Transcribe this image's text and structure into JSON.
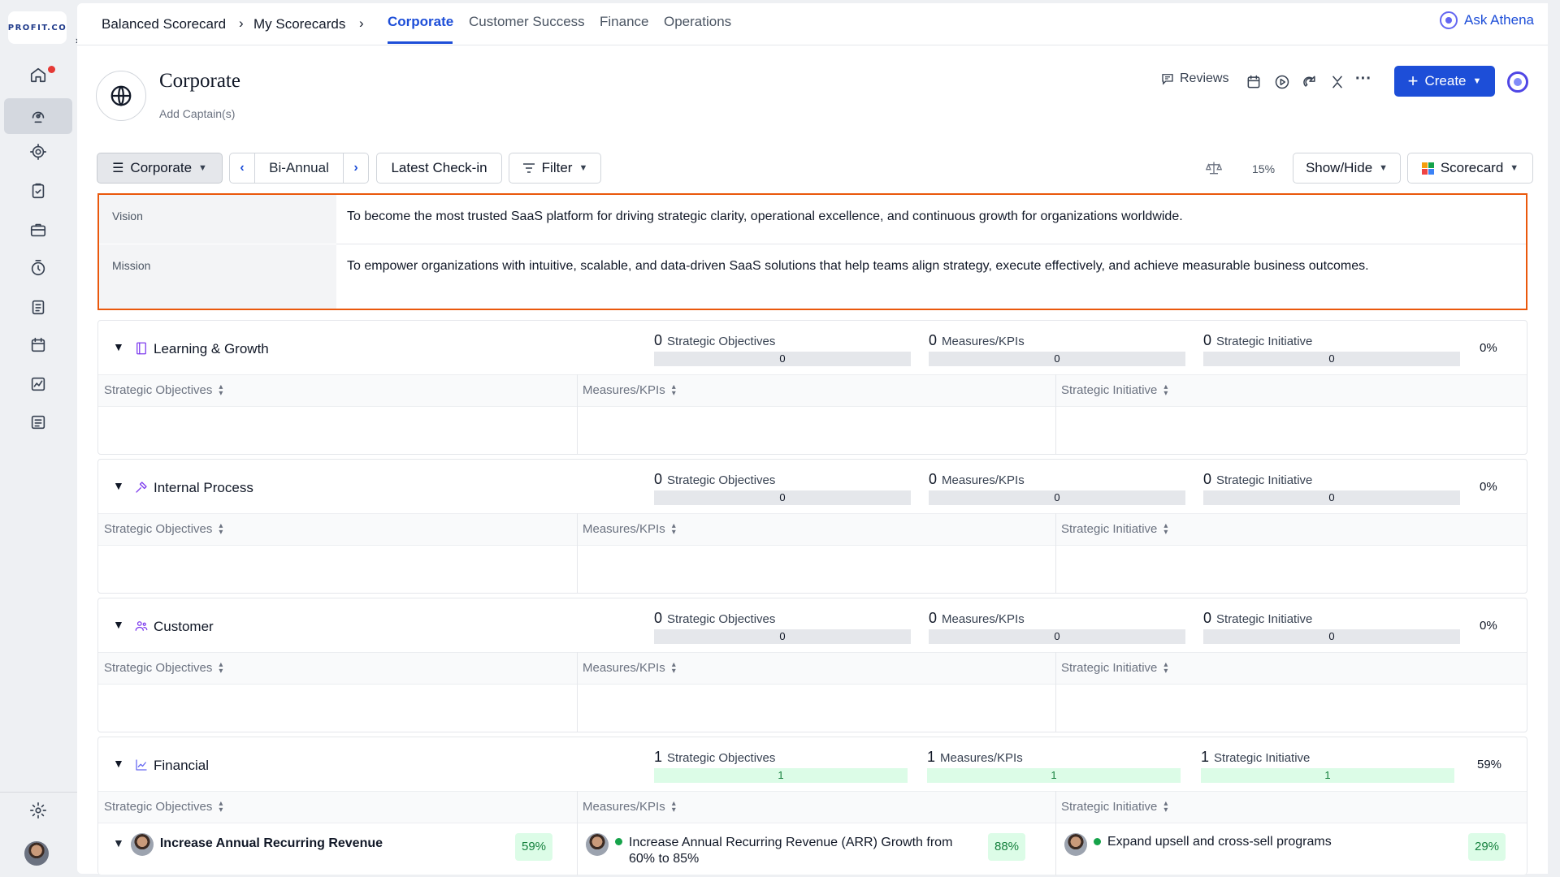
{
  "app": {
    "logo_text": "PROFIT.CO",
    "collapse_icon": "›"
  },
  "sidebar": {
    "items": [
      {
        "name": "home-icon"
      },
      {
        "name": "strategy-icon"
      },
      {
        "name": "target-icon"
      },
      {
        "name": "checklist-icon"
      },
      {
        "name": "briefcase-icon"
      },
      {
        "name": "timer-icon"
      },
      {
        "name": "clipboard-icon"
      },
      {
        "name": "calendar-icon"
      },
      {
        "name": "analytics-icon"
      },
      {
        "name": "list-icon"
      }
    ]
  },
  "breadcrumb": {
    "root": "Balanced Scorecard",
    "sep1": "›",
    "level2": "My Scorecards",
    "sep2": "›"
  },
  "tabs": [
    "Corporate",
    "Customer Success",
    "Finance",
    "Operations"
  ],
  "ask_athena": "Ask Athena",
  "header": {
    "title": "Corporate",
    "add_captain": "Add Captain(s)",
    "reviews": "Reviews",
    "more": "···",
    "create": "Create"
  },
  "toolbar": {
    "scorecard_select": "Corporate",
    "prev": "‹",
    "period": "Bi-Annual",
    "next": "›",
    "checkin": "Latest Check-in",
    "filter": "Filter",
    "weight_pct": "15%",
    "show_hide": "Show/Hide",
    "view": "Scorecard"
  },
  "vision_mission": [
    {
      "label": "Vision",
      "text": "To become the most trusted SaaS platform for driving strategic clarity, operational excellence, and continuous growth for organizations worldwide."
    },
    {
      "label": "Mission",
      "text": "To empower organizations with intuitive, scalable, and data-driven SaaS solutions that help teams align strategy, execute effectively, and achieve measurable business outcomes."
    }
  ],
  "columns": {
    "objectives": "Strategic Objectives",
    "measures": "Measures/KPIs",
    "initiatives": "Strategic Initiative"
  },
  "perspectives": [
    {
      "name": "Learning & Growth",
      "obj_count": "0",
      "obj_bar": "0",
      "kpi_count": "0",
      "kpi_bar": "0",
      "ini_count": "0",
      "ini_bar": "0",
      "progress": "0%"
    },
    {
      "name": "Internal Process",
      "obj_count": "0",
      "obj_bar": "0",
      "kpi_count": "0",
      "kpi_bar": "0",
      "ini_count": "0",
      "ini_bar": "0",
      "progress": "0%"
    },
    {
      "name": "Customer",
      "obj_count": "0",
      "obj_bar": "0",
      "kpi_count": "0",
      "kpi_bar": "0",
      "ini_count": "0",
      "ini_bar": "0",
      "progress": "0%"
    },
    {
      "name": "Financial",
      "obj_count": "1",
      "obj_bar": "1",
      "kpi_count": "1",
      "kpi_bar": "1",
      "ini_count": "1",
      "ini_bar": "1",
      "progress": "59%"
    }
  ],
  "financial_items": {
    "objective": {
      "title": "Increase Annual Recurring Revenue",
      "pct": "59%"
    },
    "measure": {
      "title": "Increase Annual Recurring Revenue (ARR) Growth from 60% to 85%",
      "pct": "88%"
    },
    "initiative": {
      "title": "Expand upsell and cross-sell programs",
      "pct": "29%"
    }
  },
  "colors": {
    "accent": "#1d4ed8",
    "highlight_border": "#ea580c",
    "success": "#16a34a",
    "success_bg": "#dcfce7"
  }
}
